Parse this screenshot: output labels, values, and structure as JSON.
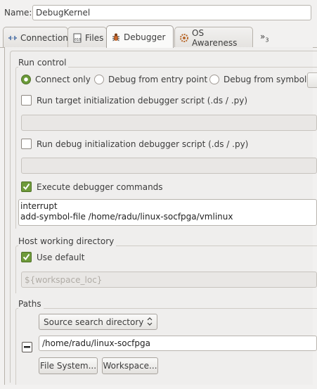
{
  "name_field": {
    "label": "Name:",
    "value": "DebugKernel"
  },
  "tabs": [
    {
      "label": "Connection",
      "icon": "connection-icon"
    },
    {
      "label": "Files",
      "icon": "files-icon"
    },
    {
      "label": "Debugger",
      "icon": "debugger-icon",
      "active": true
    },
    {
      "label": "OS Awareness",
      "icon": "os-awareness-icon"
    }
  ],
  "more_tabs": {
    "glyph": "»",
    "count": "3"
  },
  "run_control": {
    "title": "Run control",
    "radios": [
      {
        "label": "Connect only",
        "selected": true
      },
      {
        "label": "Debug from entry point",
        "selected": false
      },
      {
        "label": "Debug from symbol",
        "selected": false
      }
    ],
    "target_init": {
      "label": "Run target initialization debugger script (.ds / .py)",
      "checked": false,
      "value": ""
    },
    "debug_init": {
      "label": "Run debug initialization debugger script (.ds / .py)",
      "checked": false,
      "value": ""
    },
    "execute_cmds": {
      "label": "Execute debugger commands",
      "checked": true,
      "lines": [
        "interrupt",
        "add-symbol-file /home/radu/linux-socfpga/vmlinux"
      ]
    }
  },
  "host_working_directory": {
    "title": "Host working directory",
    "use_default": {
      "label": "Use default",
      "checked": true
    },
    "path_placeholder": "${workspace_loc}"
  },
  "paths": {
    "title": "Paths",
    "combo": "Source search directory",
    "source_path": "/home/radu/linux-socfpga",
    "file_system_button": "File System...",
    "workspace_button": "Workspace..."
  },
  "colors": {
    "accent_green": "#6a9a38",
    "tab_border": "#b7b2aa"
  }
}
